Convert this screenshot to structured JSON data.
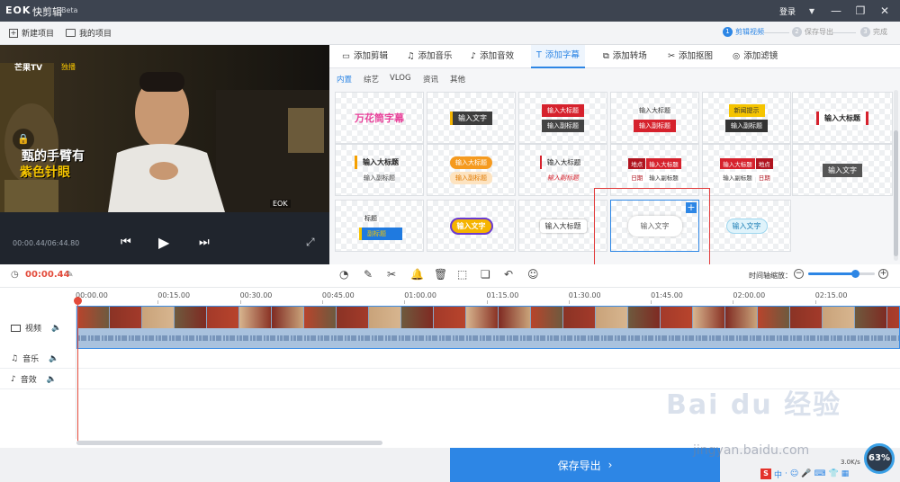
{
  "titlebar": {
    "logo": "EOK",
    "app_name": "快剪辑",
    "badge": "Beta",
    "login": "登录"
  },
  "toolbar": {
    "new_project": "新建项目",
    "my_projects": "我的项目"
  },
  "steps": [
    {
      "num": "1",
      "label": "剪辑视频",
      "active": true
    },
    {
      "num": "2",
      "label": "保存导出",
      "active": false
    },
    {
      "num": "3",
      "label": "完成",
      "active": false
    }
  ],
  "preview": {
    "channel": "芒果TV",
    "channel_sub": "独播",
    "subtitle1": "甄的手臂有",
    "subtitle2": "紫色针眼",
    "corner_logo": "EOK",
    "time": "00:00.44/06:44.80"
  },
  "tabs": [
    {
      "label": "添加剪辑",
      "icon": "film-icon"
    },
    {
      "label": "添加音乐",
      "icon": "music-icon"
    },
    {
      "label": "添加音效",
      "icon": "sound-effect-icon"
    },
    {
      "label": "添加字幕",
      "icon": "text-icon",
      "active": true
    },
    {
      "label": "添加转场",
      "icon": "transition-icon"
    },
    {
      "label": "添加抠图",
      "icon": "cutout-icon"
    },
    {
      "label": "添加滤镜",
      "icon": "filter-icon"
    }
  ],
  "subtabs": [
    {
      "label": "内置",
      "active": true
    },
    {
      "label": "综艺"
    },
    {
      "label": "VLOG"
    },
    {
      "label": "资讯"
    },
    {
      "label": "其他"
    }
  ],
  "templates": {
    "t1": "万花筒字幕",
    "t2": "输入文字",
    "t3a": "输入大标题",
    "t3b": "输入副标题",
    "t4a": "输入大标题",
    "t4b": "输入副标题",
    "t5a": "新闻提示",
    "t5b": "输入副标题",
    "t6": "输入大标题",
    "t7a": "输入大标题",
    "t7b": "输入副标题",
    "t8a": "输入大标题",
    "t8b": "输入副标题",
    "t9a": "输入大标题",
    "t9b": "输入副标题",
    "t10a": "地点",
    "t10b": "输入大标题",
    "t10c": "日期",
    "t10d": "输入副标题",
    "t11a": "输入大标题",
    "t11b": "地点",
    "t11c": "输入副标题",
    "t11d": "日期",
    "t12": "输入文字",
    "t13a": "标题",
    "t13b": "副标题",
    "t14": "输入文字",
    "t15": "输入大标题",
    "t16": "输入文字",
    "t17": "输入文字",
    "add_symbol": "+"
  },
  "timeline": {
    "current_time": "00:00.44",
    "zoom_label": "时间轴缩放：",
    "zoom_level": 0.7,
    "ruler": [
      "00:00.00",
      "00:15.00",
      "00:30.00",
      "00:45.00",
      "01:00.00",
      "01:15.00",
      "01:30.00",
      "01:45.00",
      "02:00.00",
      "02:15.00"
    ],
    "tracks": [
      "视频",
      "音乐",
      "音效"
    ]
  },
  "export_button": "保存导出",
  "overlay": {
    "watermark": "Bai du 经验",
    "url": "jingyan.baidu.com",
    "gauge": "63%",
    "speed": "3.0K/s",
    "tray_logo": "S",
    "tray_lang": "中"
  }
}
